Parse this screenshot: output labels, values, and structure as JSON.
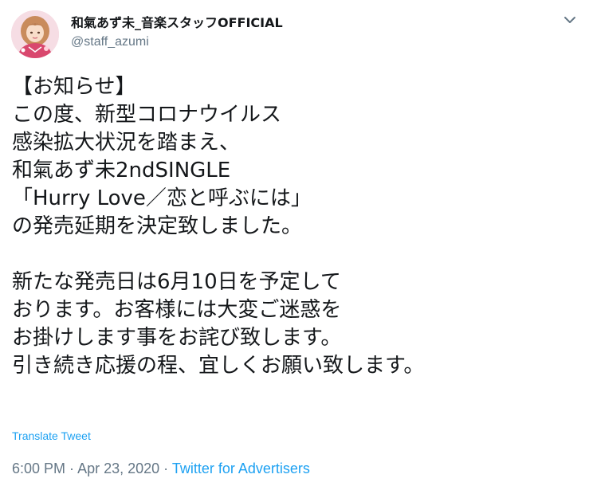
{
  "user": {
    "display_name": "和氣あず未_音楽スタッフOFFICIAL",
    "handle": "@staff_azumi",
    "avatar_icon": "avatar-photo"
  },
  "menu": {
    "icon": "chevron-down-icon"
  },
  "tweet": {
    "text": "【お知らせ】\nこの度、新型コロナウイルス\n感染拡大状況を踏まえ、\n和氣あず未2ndSINGLE\n「Hurry Love／恋と呼ぶには」\nの発売延期を決定致しました。\n\n新たな発売日は6月10日を予定して\nおります。お客様には大変ご迷惑を\nお掛けします事をお詫び致します。\n引き続き応援の程、宜しくお願い致します。",
    "translate_label": "Translate Tweet",
    "time": "6:00 PM",
    "separator_1": " · ",
    "date": "Apr 23, 2020",
    "separator_2": " · ",
    "source": "Twitter for Advertisers"
  },
  "colors": {
    "text": "#14171a",
    "secondary": "#657786",
    "link": "#1da1f2"
  }
}
